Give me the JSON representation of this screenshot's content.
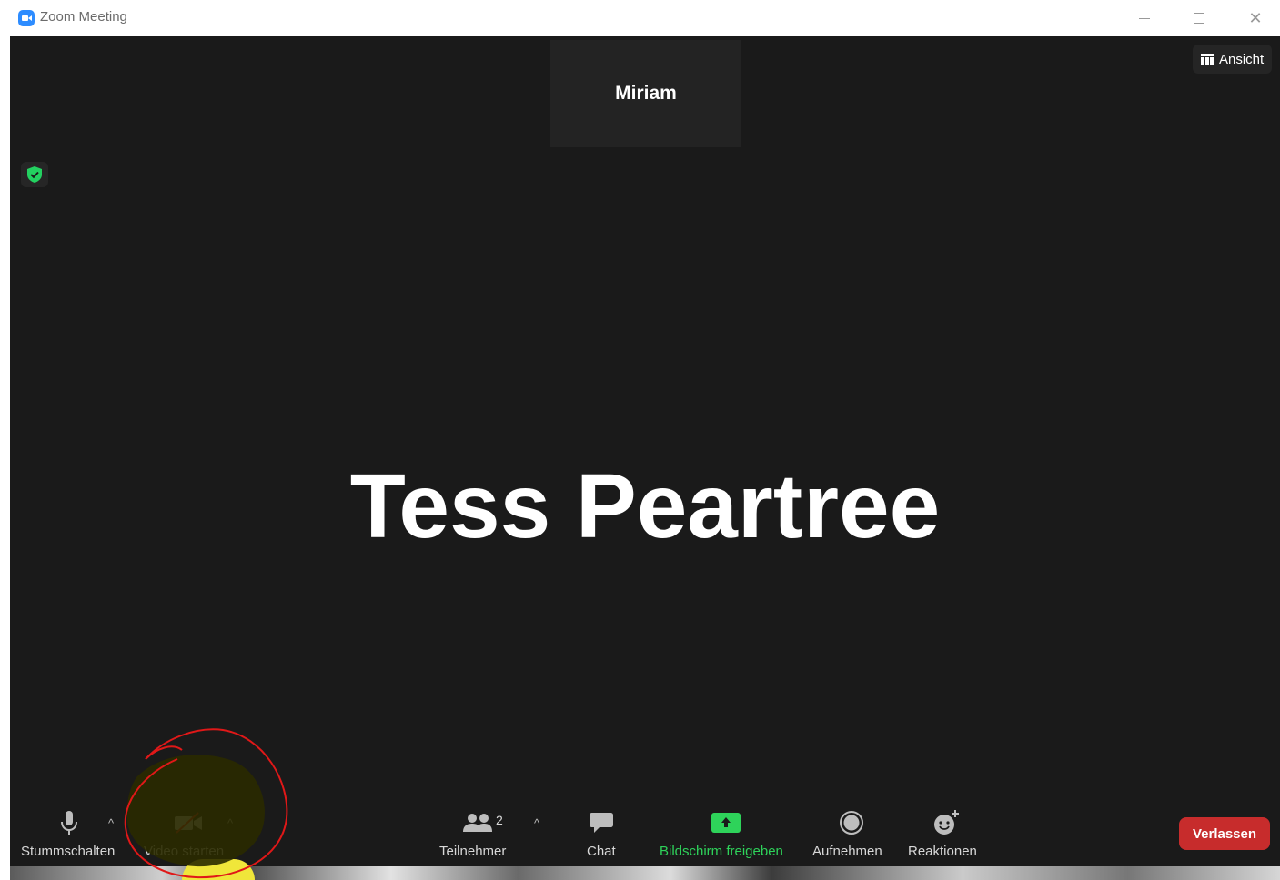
{
  "window": {
    "title": "Zoom Meeting"
  },
  "meeting": {
    "thumbnail_name": "Miriam",
    "active_speaker": "Tess Peartree",
    "view_button_label": "Ansicht"
  },
  "toolbar": {
    "mute_label": "Stummschalten",
    "video_label": "Video starten",
    "participants_label": "Teilnehmer",
    "participants_count": "2",
    "chat_label": "Chat",
    "share_label": "Bildschirm freigeben",
    "record_label": "Aufnehmen",
    "reactions_label": "Reaktionen",
    "leave_label": "Verlassen"
  },
  "icons": {
    "app": "zoom-camera-icon",
    "view": "grid-icon",
    "security": "shield-check-icon",
    "mute": "microphone-icon",
    "video": "video-off-icon",
    "participants": "people-icon",
    "chat": "chat-bubble-icon",
    "share": "share-screen-arrow-icon",
    "record": "record-icon",
    "reactions": "emoji-plus-icon"
  },
  "colors": {
    "accent": "#2d8cff",
    "share_green": "#2ed35a",
    "leave_red": "#c72c2c",
    "security_green": "#23d160",
    "annotation_red": "#e01818",
    "annotation_highlight": "#2a2a00"
  }
}
